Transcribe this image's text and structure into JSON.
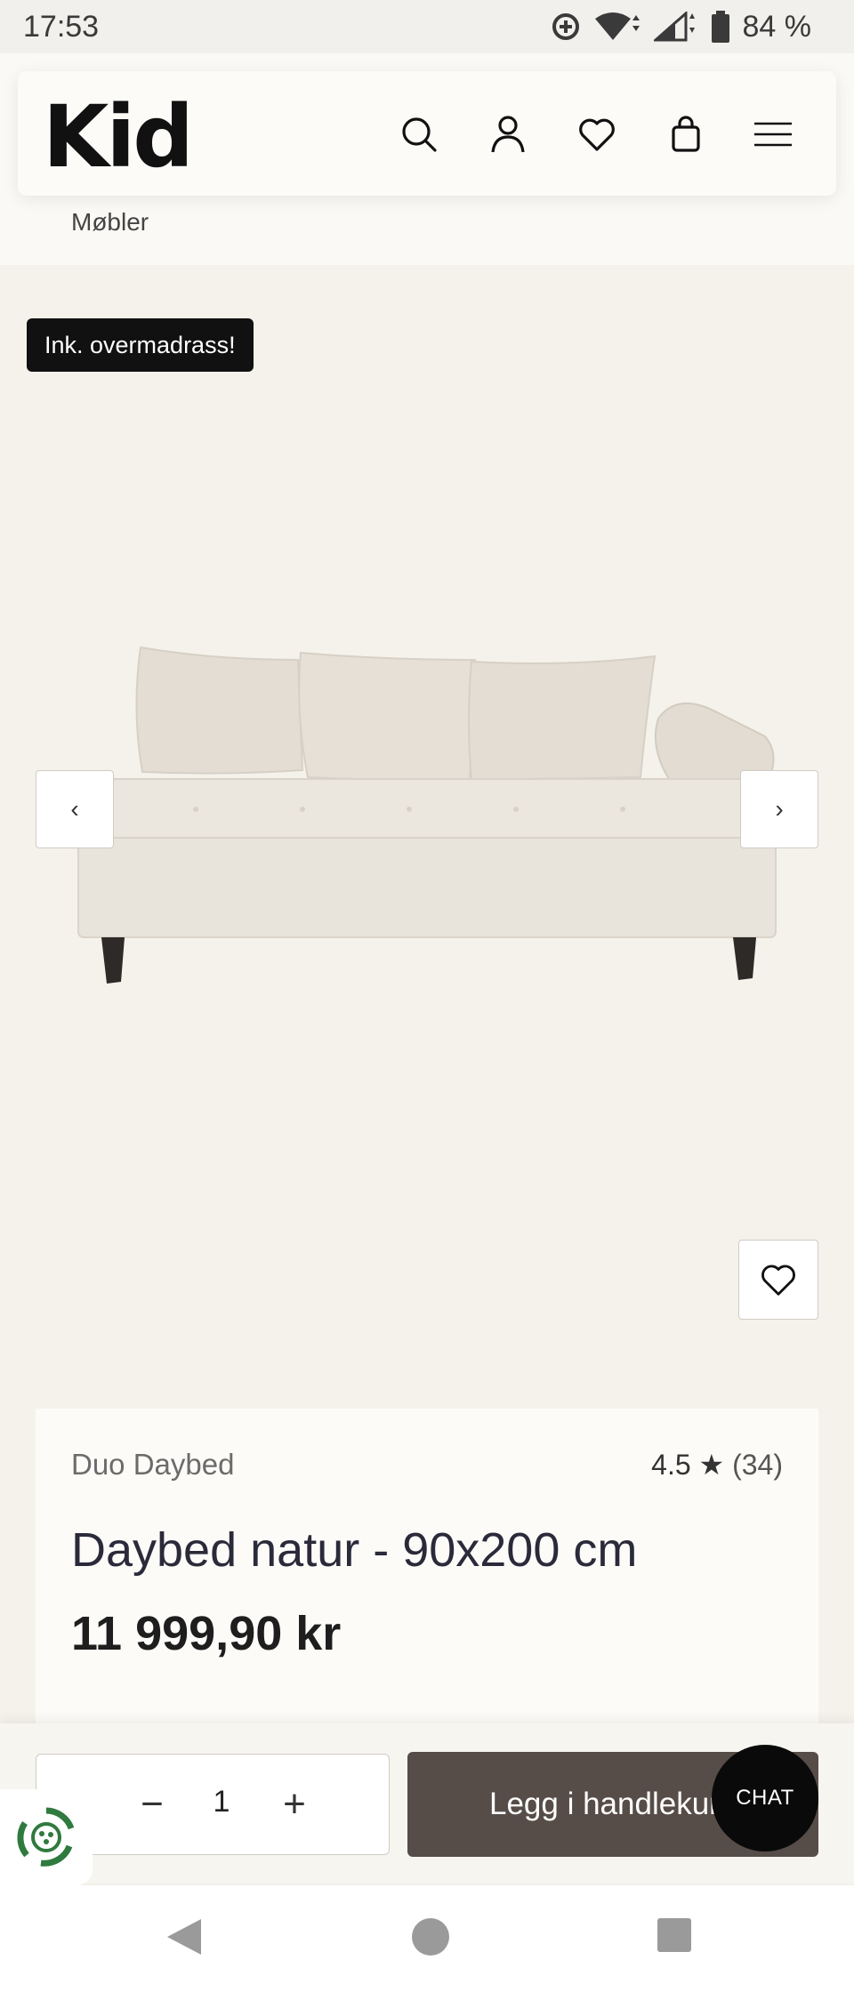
{
  "status_bar": {
    "time": "17:53",
    "battery": "84 %"
  },
  "header": {
    "logo": "Kid",
    "icons": [
      "search-icon",
      "account-icon",
      "heart-icon",
      "bag-icon",
      "menu-icon"
    ]
  },
  "breadcrumb": "Møbler",
  "gallery": {
    "badge": "Ink. overmadrass!",
    "prev_label": "‹",
    "next_label": "›"
  },
  "product": {
    "brand": "Duo Daybed",
    "rating": "4.5",
    "rating_star": "★",
    "rating_count": "(34)",
    "title": "Daybed natur - 90x200 cm",
    "price": "11 999,90 kr"
  },
  "cart": {
    "minus": "−",
    "quantity": "1",
    "plus": "+",
    "add_label": "Legg i handlekurv",
    "chat_label": "CHAT"
  },
  "colors": {
    "accent_button": "#574d48",
    "page_background": "#f4f2ea",
    "badge_background": "#111111"
  }
}
